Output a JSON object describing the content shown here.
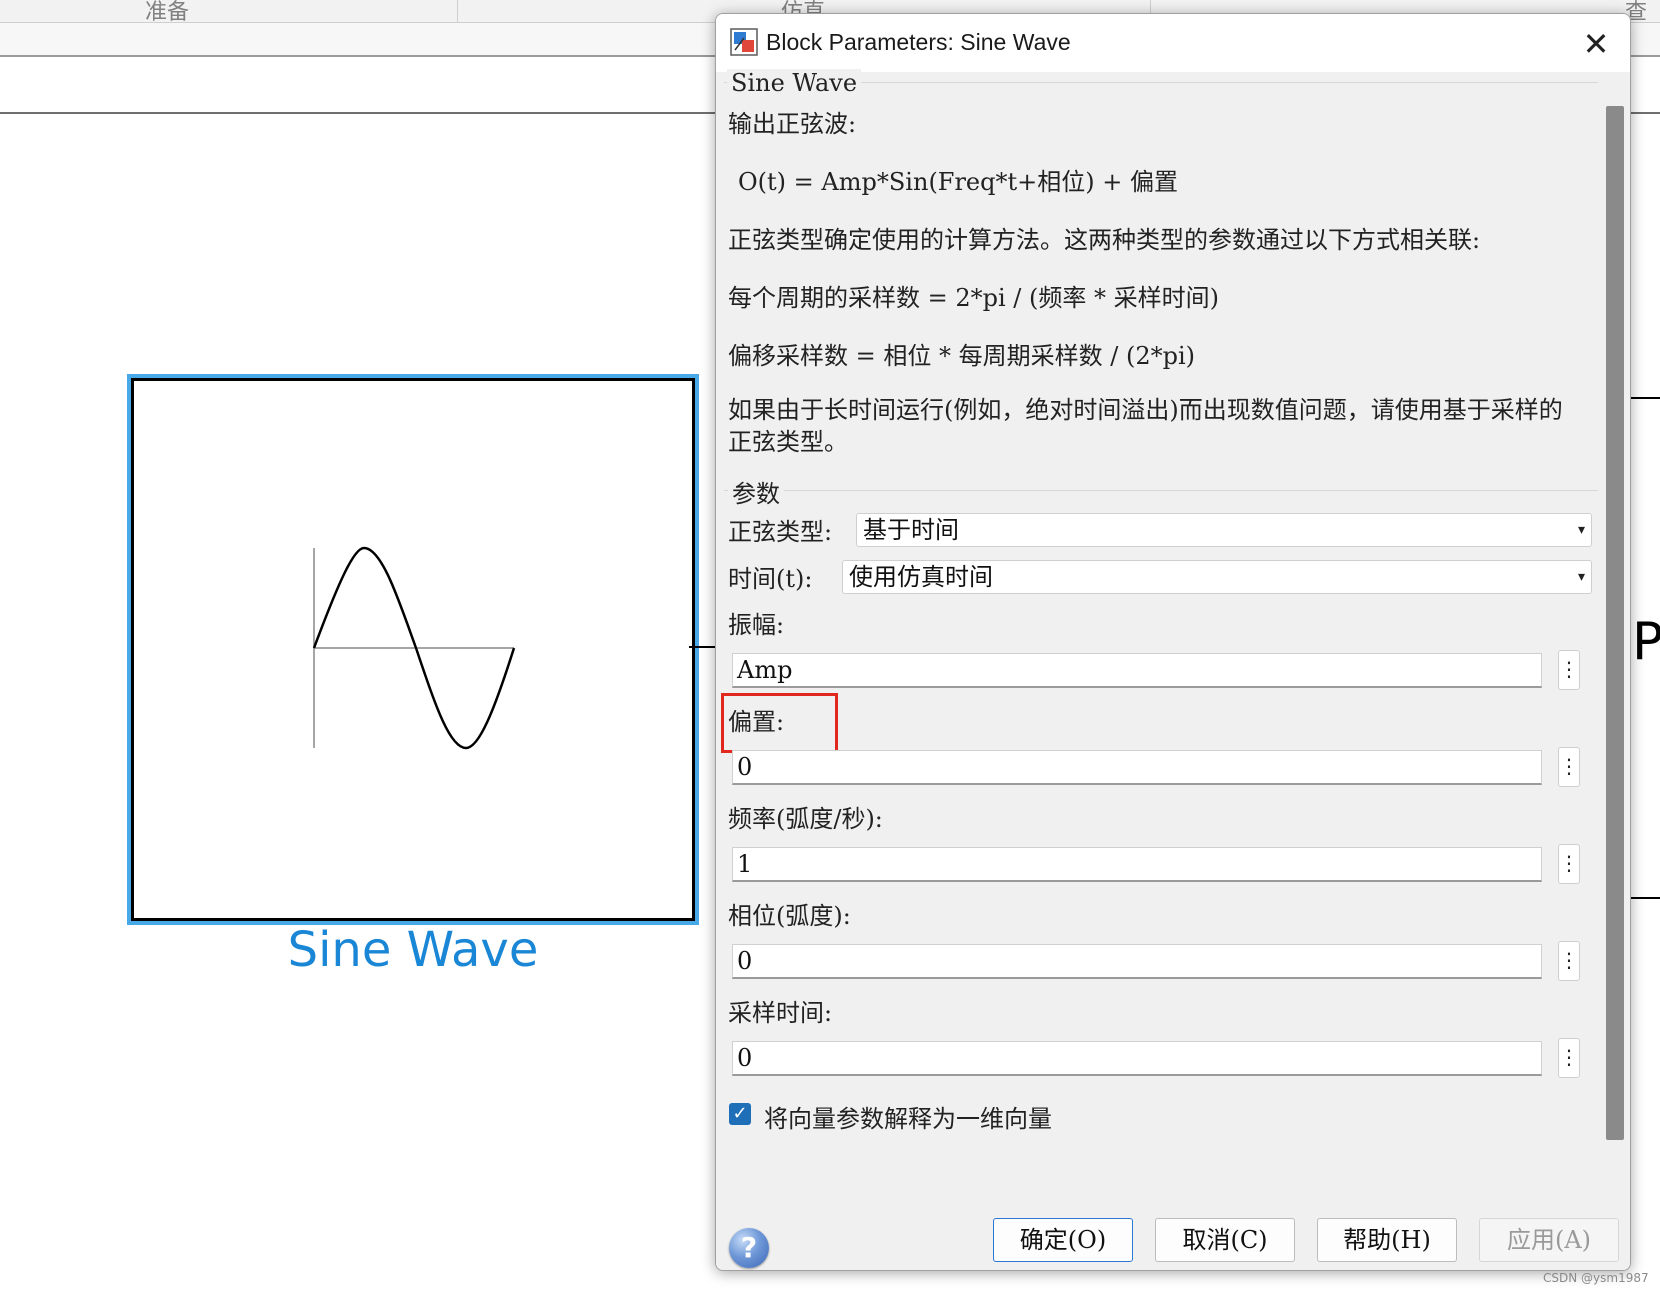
{
  "background": {
    "tabs": [
      "准备",
      "仿直",
      "查看"
    ],
    "block_label": "Sine Wave",
    "right_partial_text": "Plo"
  },
  "dialog": {
    "title": "Block Parameters: Sine Wave",
    "close_glyph": "✕",
    "section_title": "Sine Wave",
    "description": {
      "line1": "输出正弦波:",
      "formula": "O(t) = Amp*Sin(Freq*t+相位) + 偏置",
      "line3": "正弦类型确定使用的计算方法。这两种类型的参数通过以下方式相关联:",
      "line4": "每个周期的采样数 = 2*pi / (频率 * 采样时间)",
      "line5": "偏移采样数 = 相位 * 每周期采样数 / (2*pi)",
      "line6": "如果由于长时间运行(例如，绝对时间溢出)而出现数值问题，请使用基于采样的正弦类型。"
    },
    "params_title": "参数",
    "sine_type": {
      "label": "正弦类型:",
      "value": "基于时间"
    },
    "time": {
      "label": "时间(t):",
      "value": "使用仿真时间"
    },
    "fields": [
      {
        "label": "振幅:",
        "value": "Amp"
      },
      {
        "label": "偏置:",
        "value": "0"
      },
      {
        "label": "频率(弧度/秒):",
        "value": "1"
      },
      {
        "label": "相位(弧度):",
        "value": "0"
      },
      {
        "label": "采样时间:",
        "value": "0"
      }
    ],
    "more_glyph": "⋮",
    "checkbox": {
      "label": "将向量参数解释为一维向量",
      "checked": true,
      "glyph": "✓"
    },
    "buttons": {
      "ok": "确定(O)",
      "cancel": "取消(C)",
      "help": "帮助(H)",
      "apply": "应用(A)"
    },
    "help_glyph": "?"
  },
  "watermark": "CSDN @ysm1987",
  "colors": {
    "highlight": "#e0281f",
    "block_selected": "#48a9e8",
    "block_label": "#1a86d6",
    "checkbox": "#1f6fb8"
  }
}
